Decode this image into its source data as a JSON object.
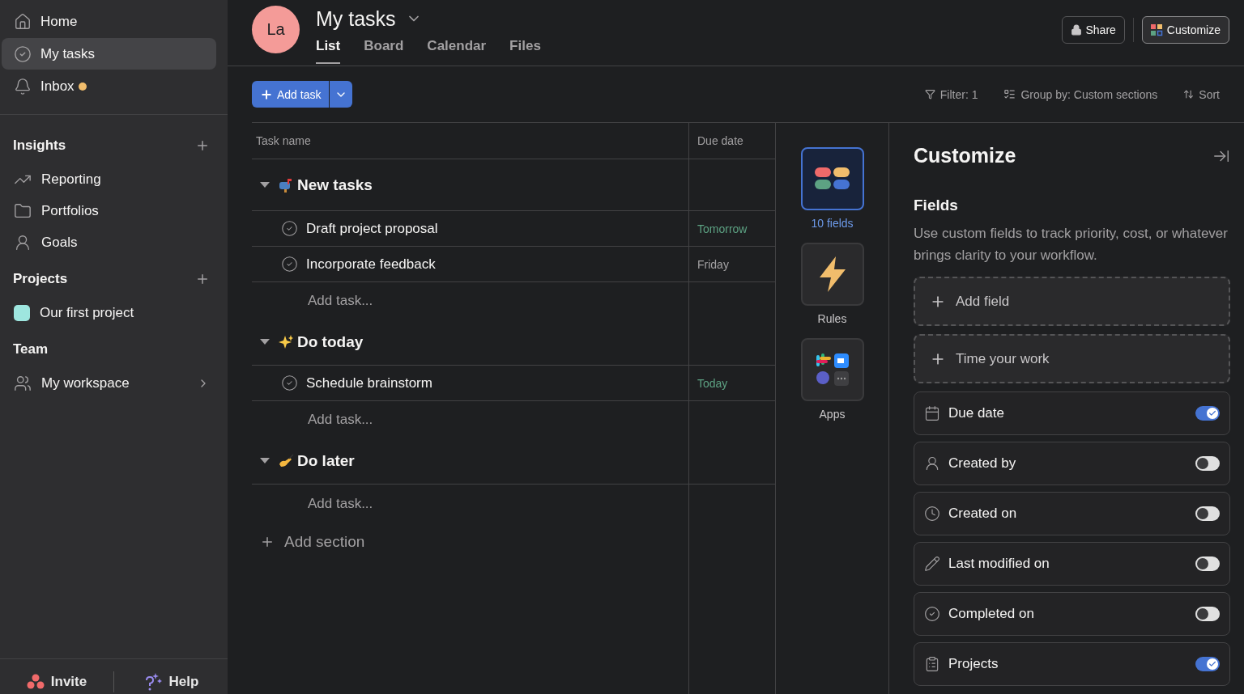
{
  "sidebar": {
    "nav": [
      {
        "label": "Home",
        "selected": false
      },
      {
        "label": "My tasks",
        "selected": true
      },
      {
        "label": "Inbox",
        "selected": false,
        "unread": true
      }
    ],
    "sections": [
      {
        "title": "Insights",
        "addable": true,
        "items": [
          {
            "label": "Reporting"
          },
          {
            "label": "Portfolios"
          },
          {
            "label": "Goals"
          }
        ]
      },
      {
        "title": "Projects",
        "addable": true,
        "items": [
          {
            "label": "Our first project",
            "color": "#9ee6df"
          }
        ]
      },
      {
        "title": "Team",
        "addable": false,
        "items": [
          {
            "label": "My workspace",
            "chevron": true
          }
        ]
      }
    ],
    "footer": {
      "invite": "Invite",
      "help": "Help"
    }
  },
  "header": {
    "avatar": "La",
    "title": "My tasks",
    "tabs": [
      {
        "label": "List",
        "selected": true
      },
      {
        "label": "Board",
        "selected": false
      },
      {
        "label": "Calendar",
        "selected": false
      },
      {
        "label": "Files",
        "selected": false
      }
    ],
    "share": "Share",
    "customize": "Customize"
  },
  "toolbar": {
    "add_task": "Add task",
    "filter": "Filter: 1",
    "group_by": "Group by: Custom sections",
    "sort": "Sort"
  },
  "table": {
    "columns": [
      "Task name",
      "Due date"
    ],
    "sections": [
      {
        "title": "New tasks",
        "tasks": [
          {
            "name": "Draft project proposal",
            "due": "Tomorrow",
            "color": "#5da283"
          },
          {
            "name": "Incorporate feedback",
            "due": "Friday",
            "color": "#a2a0a2"
          }
        ],
        "add_task": "Add task..."
      },
      {
        "title": "Do today",
        "tasks": [
          {
            "name": "Schedule brainstorm",
            "due": "Today",
            "color": "#5da283"
          }
        ],
        "add_task": "Add task..."
      },
      {
        "title": "Do later",
        "add_task": "Add task..."
      }
    ],
    "add_section": "Add section"
  },
  "customize": {
    "rail": [
      {
        "label": "10 fields",
        "selected": true
      },
      {
        "label": "Rules",
        "selected": false
      },
      {
        "label": "Apps",
        "selected": false
      }
    ],
    "title": "Customize",
    "fields_heading": "Fields",
    "description": "Use custom fields to track priority, cost, or whatever brings clarity to your workflow.",
    "actions": [
      "Add field",
      "Time your work"
    ],
    "fields": [
      {
        "label": "Due date",
        "on": true
      },
      {
        "label": "Created by",
        "on": false
      },
      {
        "label": "Created on",
        "on": false
      },
      {
        "label": "Last modified on",
        "on": false
      },
      {
        "label": "Completed on",
        "on": false
      },
      {
        "label": "Projects",
        "on": true
      }
    ]
  }
}
